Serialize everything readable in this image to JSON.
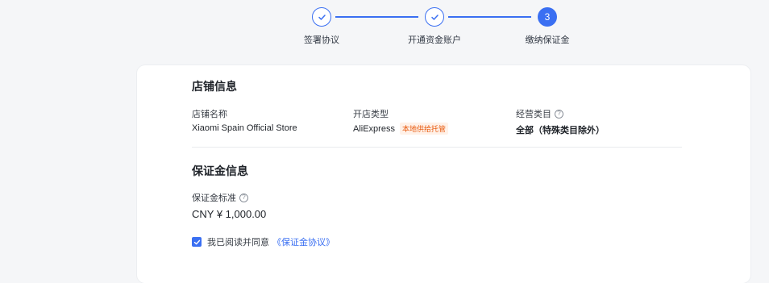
{
  "stepper": {
    "steps": [
      {
        "label": "签署协议",
        "status": "done"
      },
      {
        "label": "开通资金账户",
        "status": "done"
      },
      {
        "label": "缴纳保证金",
        "status": "active",
        "number": "3"
      }
    ]
  },
  "store_info": {
    "title": "店铺信息",
    "fields": [
      {
        "label": "店铺名称",
        "value": "Xiaomi Spain Official Store"
      },
      {
        "label": "开店类型",
        "value": "AliExpress",
        "tag": "本地供给托管"
      },
      {
        "label": "经营类目",
        "value": "全部（特殊类目除外）",
        "help_icon": "question-circle-icon"
      }
    ]
  },
  "deposit_info": {
    "title": "保证金信息",
    "standard_label": "保证金标准",
    "help_icon": "question-circle-icon",
    "amount": "CNY ¥ 1,000.00"
  },
  "agreement": {
    "checked": true,
    "text": "我已阅读并同意",
    "link": "《保证金协议》"
  },
  "colors": {
    "accent": "#3a6ff2",
    "tag_text": "#e8590c",
    "tag_bg": "#fff1e8",
    "background": "#f5f6f8"
  }
}
